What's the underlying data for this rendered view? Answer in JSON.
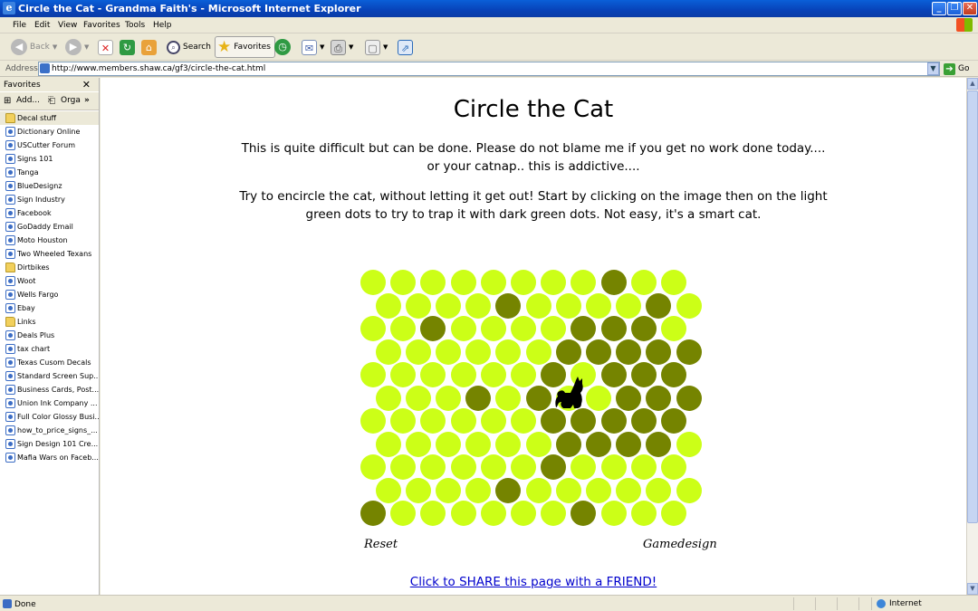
{
  "window": {
    "title": "Circle the Cat - Grandma Faith's - Microsoft Internet Explorer"
  },
  "menu": [
    "File",
    "Edit",
    "View",
    "Favorites",
    "Tools",
    "Help"
  ],
  "toolbar": {
    "back": "Back",
    "search": "Search",
    "favorites": "Favorites"
  },
  "address": {
    "label": "Address",
    "url": "http://www.members.shaw.ca/gf3/circle-the-cat.html",
    "go": "Go"
  },
  "sidebar": {
    "title": "Favorites",
    "add": "Add...",
    "organize": "Orga",
    "items": [
      {
        "label": "Decal stuff",
        "type": "folder"
      },
      {
        "label": "Dictionary Online",
        "type": "page"
      },
      {
        "label": "USCutter Forum",
        "type": "page"
      },
      {
        "label": "Signs 101",
        "type": "page"
      },
      {
        "label": "Tanga",
        "type": "page"
      },
      {
        "label": "BlueDesignz",
        "type": "page"
      },
      {
        "label": "Sign Industry",
        "type": "page"
      },
      {
        "label": "Facebook",
        "type": "page"
      },
      {
        "label": "GoDaddy Email",
        "type": "page"
      },
      {
        "label": "Moto Houston",
        "type": "page"
      },
      {
        "label": "Two Wheeled Texans",
        "type": "page"
      },
      {
        "label": "Dirtbikes",
        "type": "folder"
      },
      {
        "label": "Woot",
        "type": "page"
      },
      {
        "label": "Wells Fargo",
        "type": "page"
      },
      {
        "label": "Ebay",
        "type": "page"
      },
      {
        "label": "Links",
        "type": "folder"
      },
      {
        "label": "Deals Plus",
        "type": "page"
      },
      {
        "label": "tax chart",
        "type": "page"
      },
      {
        "label": "Texas Cusom Decals",
        "type": "page"
      },
      {
        "label": "Standard Screen Sup...",
        "type": "page"
      },
      {
        "label": "Business Cards, Post...",
        "type": "page"
      },
      {
        "label": "Union Ink Company ...",
        "type": "page"
      },
      {
        "label": "Full Color Glossy Busi...",
        "type": "page"
      },
      {
        "label": "how_to_price_signs_...",
        "type": "page"
      },
      {
        "label": "Sign Design 101 Cre...",
        "type": "page"
      },
      {
        "label": "Mafia Wars on Faceb...",
        "type": "page"
      }
    ]
  },
  "page": {
    "title": "Circle the Cat",
    "para1": "This is quite difficult but can be done. Please  do not blame me if you get no work done today.... or your catnap.. this is addictive....",
    "para2": "Try to encircle the cat, without letting it get out! Start by clicking on the image then on the light green dots to try to trap it with dark green dots. Not easy, it's a smart cat.",
    "reset": "Reset",
    "gamedesign": "Gamedesign",
    "share": "Click to SHARE this page with a FRIEND!"
  },
  "game": {
    "light_color": "#ccff17",
    "dark_color": "#758400",
    "rows": 11,
    "cols": 11,
    "dark_cells": [
      [
        0,
        8
      ],
      [
        1,
        4
      ],
      [
        1,
        9
      ],
      [
        2,
        2
      ],
      [
        2,
        7
      ],
      [
        2,
        8
      ],
      [
        2,
        9
      ],
      [
        3,
        6
      ],
      [
        3,
        7
      ],
      [
        3,
        8
      ],
      [
        3,
        9
      ],
      [
        3,
        10
      ],
      [
        4,
        6
      ],
      [
        4,
        8
      ],
      [
        4,
        9
      ],
      [
        4,
        10
      ],
      [
        5,
        3
      ],
      [
        5,
        5
      ],
      [
        5,
        8
      ],
      [
        5,
        9
      ],
      [
        5,
        10
      ],
      [
        6,
        6
      ],
      [
        6,
        7
      ],
      [
        6,
        8
      ],
      [
        6,
        9
      ],
      [
        6,
        10
      ],
      [
        7,
        6
      ],
      [
        7,
        7
      ],
      [
        7,
        8
      ],
      [
        7,
        9
      ],
      [
        8,
        6
      ],
      [
        9,
        4
      ],
      [
        10,
        0
      ],
      [
        10,
        7
      ]
    ],
    "cat_cell": [
      5,
      6
    ]
  },
  "status": {
    "text": "Done",
    "zone": "Internet"
  }
}
